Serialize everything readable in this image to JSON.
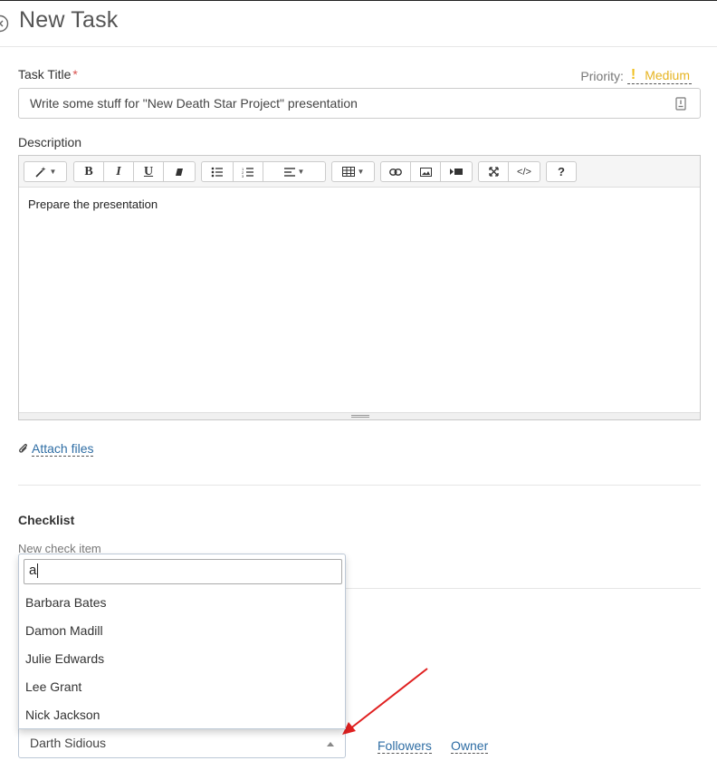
{
  "header": {
    "title": "New Task"
  },
  "task_title": {
    "label": "Task Title",
    "required_marker": "*",
    "value": "Write some stuff for \"New Death Star Project\" presentation"
  },
  "priority": {
    "label": "Priority:",
    "icon_glyph": "!",
    "value": "Medium",
    "color": "#e6b422"
  },
  "description": {
    "label": "Description",
    "content": "Prepare the presentation",
    "toolbar": {
      "bold": "B",
      "italic": "I",
      "underline": "U",
      "help": "?",
      "code": "</>"
    }
  },
  "attach": {
    "label": "Attach files"
  },
  "checklist": {
    "title": "Checklist",
    "new_item_placeholder": "New check item"
  },
  "user_dropdown": {
    "search_value": "a",
    "options": [
      "Barbara Bates",
      "Damon Madill",
      "Julie Edwards",
      "Lee Grant",
      "Nick Jackson"
    ],
    "selected": "Darth Sidious"
  },
  "tabs": {
    "followers": "Followers",
    "owner": "Owner"
  },
  "colors": {
    "link": "#2e6da4",
    "required": "#d9534f",
    "annotation_arrow": "#e02020"
  }
}
